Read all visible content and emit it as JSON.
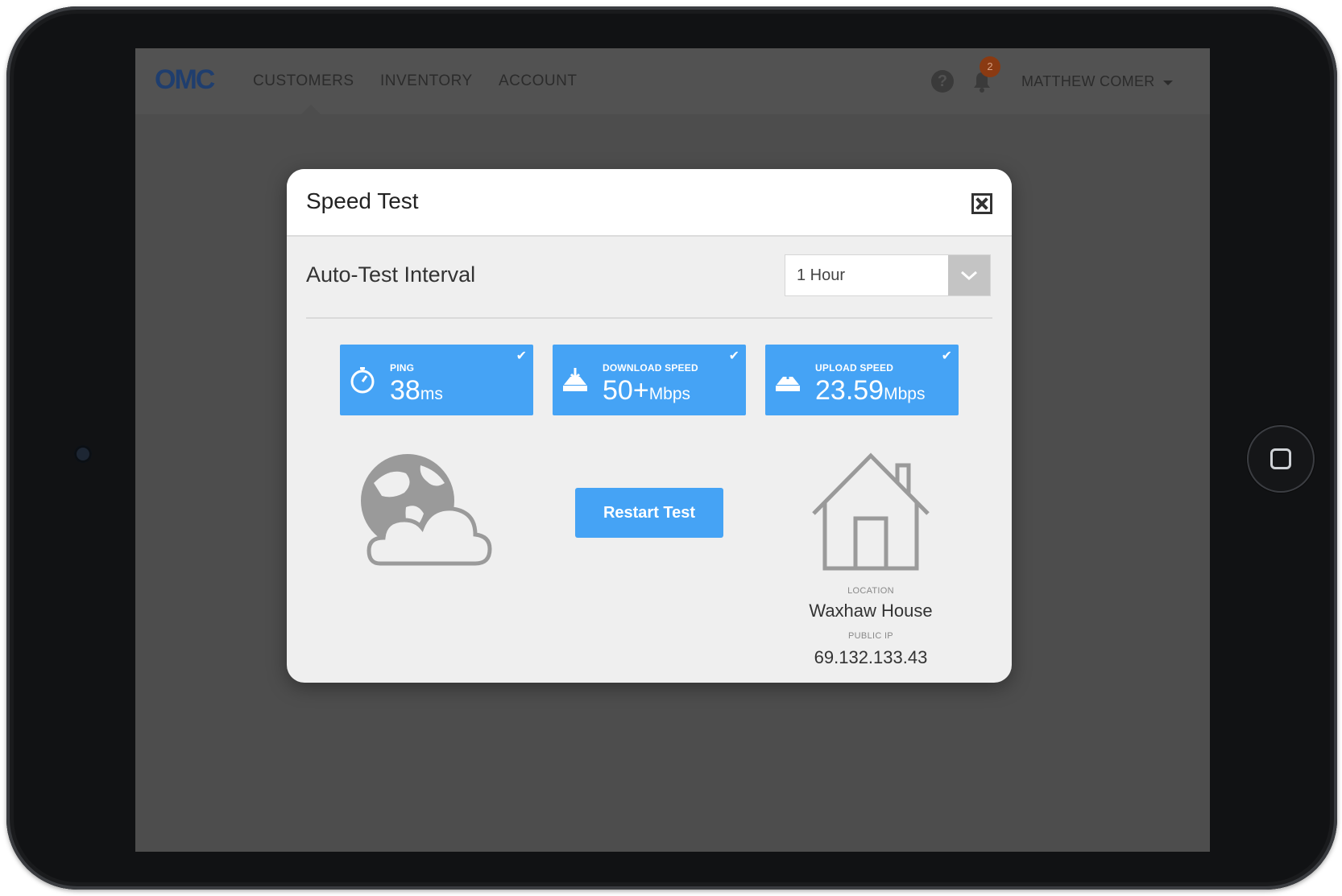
{
  "app": {
    "logo_text": "OMC",
    "nav": [
      {
        "label": "CUSTOMERS"
      },
      {
        "label": "INVENTORY"
      },
      {
        "label": "ACCOUNT"
      }
    ],
    "notification_count": "2",
    "user_name": "MATTHEW COMER"
  },
  "modal": {
    "title": "Speed Test",
    "interval": {
      "label": "Auto-Test Interval",
      "selected": "1 Hour"
    },
    "metrics": [
      {
        "label": "PING",
        "value": "38",
        "unit": "ms",
        "icon": "stopwatch-icon"
      },
      {
        "label": "DOWNLOAD SPEED",
        "value": "50+",
        "unit": "Mbps",
        "icon": "download-icon"
      },
      {
        "label": "UPLOAD SPEED",
        "value": "23.59",
        "unit": "Mbps",
        "icon": "upload-icon"
      }
    ],
    "restart_label": "Restart Test",
    "location": {
      "caption": "LOCATION",
      "name": "Waxhaw House",
      "ip_caption": "PUBLIC IP",
      "ip": "69.132.133.43"
    }
  },
  "colors": {
    "accent": "#45a3f5",
    "overlay": "#4d4d4d",
    "modal_bg": "#efefef"
  }
}
